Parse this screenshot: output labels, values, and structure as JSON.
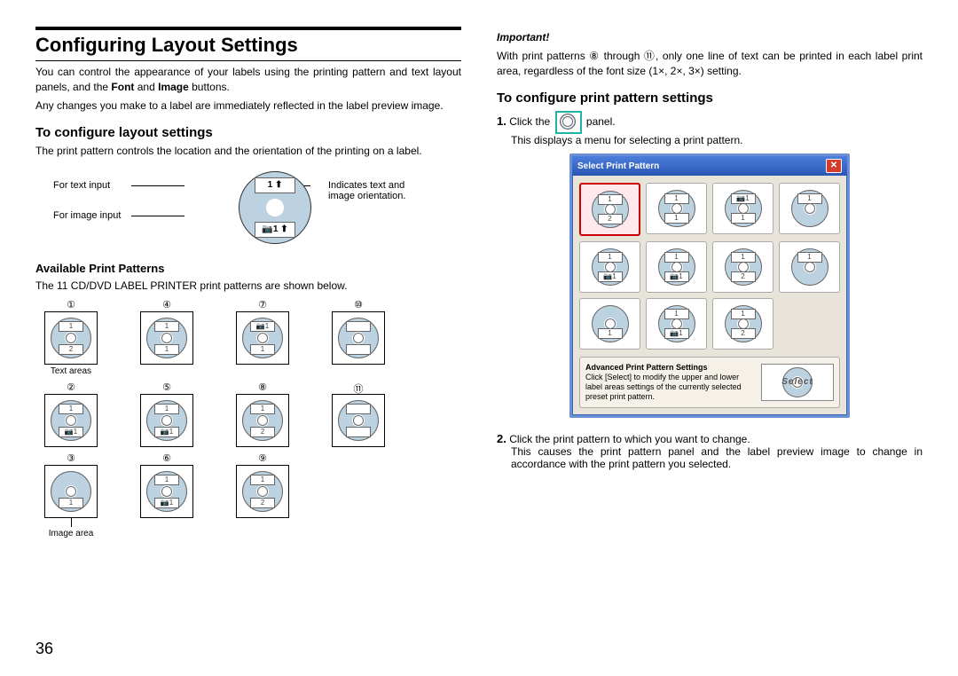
{
  "page_number": "36",
  "heading": "Configuring Layout Settings",
  "intro1": "You can control the appearance of your labels using the printing pattern and text layout panels, and the Font and Image buttons.",
  "intro2": "Any changes you make to a label are immediately reflected in the label preview image.",
  "sec1": {
    "title": "To configure layout settings",
    "body": "The print pattern controls the location and the orientation of the printing on a label.",
    "labels": {
      "text_input": "For text input",
      "image_input": "For image input",
      "orientation": "Indicates text and image orientation."
    }
  },
  "sec2": {
    "title": "Available Print Patterns",
    "body": "The 11 CD/DVD LABEL PRINTER print patterns are shown below.",
    "text_areas": "Text areas",
    "image_area": "Image area",
    "circled": [
      "①",
      "②",
      "③",
      "④",
      "⑤",
      "⑥",
      "⑦",
      "⑧",
      "⑨",
      "⑩",
      "⑪"
    ]
  },
  "col2": {
    "important_label": "Important!",
    "important_body": "With print patterns ⑧ through ⑪, only one line of text can be printed in each label print area, regardless of the font size (1×, 2×, 3×) setting.",
    "title": "To configure print pattern settings",
    "step1a": "Click the",
    "step1b": "panel.",
    "step1c": "This displays a menu for selecting a print pattern.",
    "step2a": "Click the print pattern to which you want to change.",
    "step2b": "This causes the print pattern panel and the label preview image to change in accordance with the print pattern you selected."
  },
  "dialog": {
    "title": "Select Print Pattern",
    "adv_title": "Advanced Print Pattern Settings",
    "adv_body": "Click [Select] to modify the upper and lower label areas settings of the currently selected preset print pattern.",
    "select": "Select"
  }
}
